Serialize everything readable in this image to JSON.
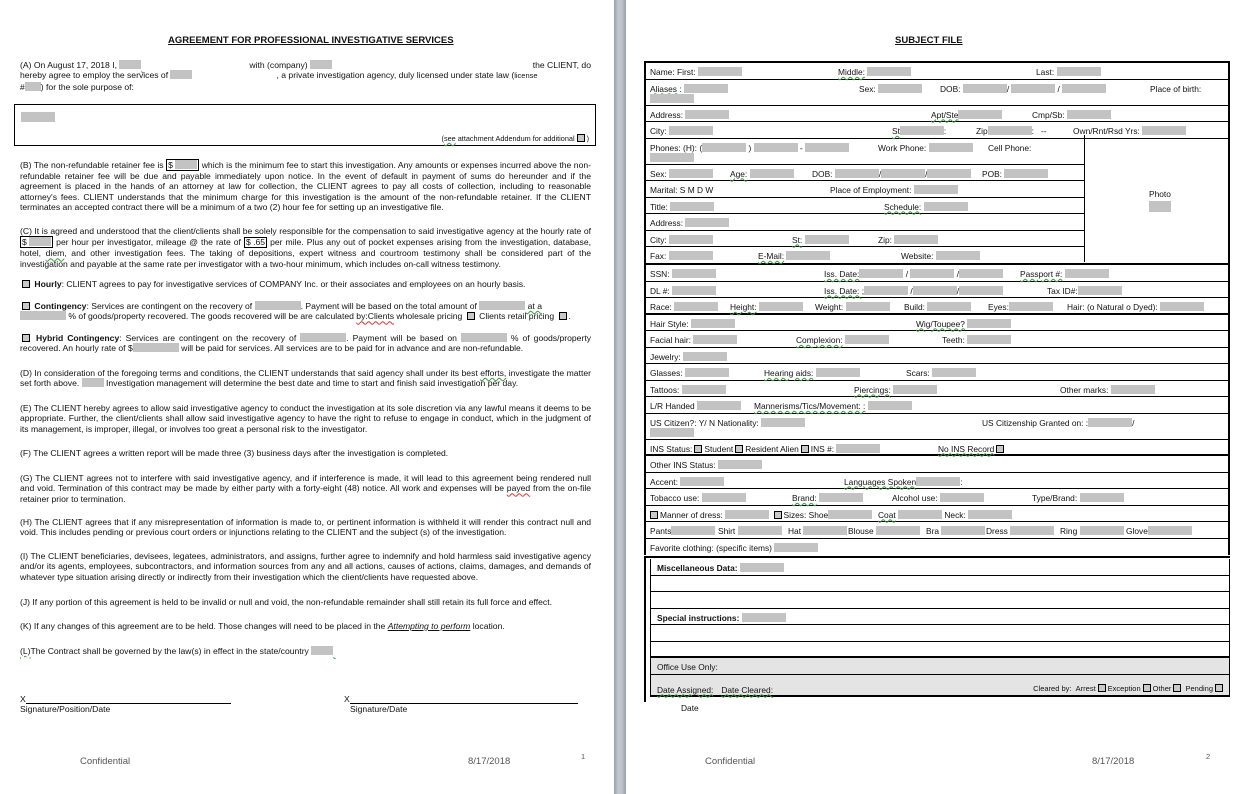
{
  "page1": {
    "title": "AGREEMENT FOR PROFESSIONAL INVESTIGATIVE SERVICES",
    "a": {
      "l1_start": "(A) On August 17, 2018    I,",
      "l1_with": "with (company)",
      "l1_end": "the CLIENT, do",
      "l2_start": "hereby agree to employ the services of",
      "l2_end": ", a private investigation agency, duly licensed under state law (",
      "l2_license": "license",
      "l3_hash": "#",
      "l3_end": ") for the sole purpose of:"
    },
    "purpose_note_see": "see",
    "purpose_note_rest": " attachment Addendum for additional",
    "b": {
      "start": "(B) The non-refundable retainer fee is ",
      "dollar": "$",
      "rest": " which is the minimum fee to start this investigation. Any amounts or expenses incurred above the non-refundable retainer fee will be due and payable immediately upon notice. In the event of default in payment of sums do hereunder and if the agreement is placed in the hands of an attorney at law for collection, the CLIENT agrees to pay all costs of collection, including to reasonable attorney's fees. CLIENT understands that the minimum charge for this investigation is the amount of the non-refundable retainer.  If the CLIENT terminates an accepted contract there will be a minimum of a two (2) hour fee for setting up an investigative file."
    },
    "c": {
      "start": "(C) It is agreed and understood that the client/clients shall be solely responsible for the compensation to said investigative agency at the hourly rate of ",
      "dollar": "$",
      "mid": " per hour per investigator, mileage @ the rate of ",
      "mileage": "$ .65",
      "rest1": " per mile. Plus any out of pocket expenses arising from the investigation, database, hotel, ",
      "diem": "diem",
      "rest2": ", and other investigation fees. The taking of depositions, expert witness and courtroom testimony shall be considered part of the investigation and payable at the same rate per investigator with a two-hour minimum, which includes on-call witness testimony."
    },
    "hourly": {
      "label": "Hourly",
      "text": ": CLIENT agrees to pay for investigative services of COMPANY Inc. or their associates and employees on an hourly basis."
    },
    "contingency": {
      "label": "Contingency",
      "t1": ": Services are contingent on the recovery of ",
      "t2": ".   Payment will be based on the total amount of ",
      "t3": " at a",
      "t4": " % of goods/property recovered.  The goods recovered will be are calculated ",
      "by_clients": "by:Clients",
      "t5": " wholesale pricing ",
      "t6": " Clients retail pricing ",
      "t7": "."
    },
    "hybrid": {
      "label": "Hybrid Contingency",
      "t1": ": Services are contingent on the recovery of ",
      "t2": ".  Payment will be based on ",
      "t3": " % of goods/property recovered. An hourly rate of $",
      "t4": " will be paid for services. All services are to be paid for in advance and are non-refundable."
    },
    "d": {
      "t1": "(D) In consideration of the foregoing terms and conditions, the CLIENT understands that said agency shall under its best ",
      "efforts": "efforts,",
      "t2": " investigate the matter set forth above. ",
      "t3": " Investigation management will determine the best date and time to start and finish said investigation per day."
    },
    "e": "(E) The CLIENT hereby agrees to allow said investigative agency to conduct the investigation at its sole discretion via any lawful means it deems to be appropriate. Further, the client/clients shall allow said investigative agency to have the right to refuse to engage in conduct, which in the judgment of its management, is improper, illegal, or involves too great a personal risk to the investigator.",
    "f": "(F) The CLIENT agrees a written report will be made three (3) business days after the investigation is completed.",
    "g": {
      "t1": "(G) The CLIENT agrees not to interfere with said investigative agency, and if interference is made, it will lead to this agreement being rendered null and void.  Termination of this contract may be made by either party with a forty-eight (48) notice.  All work and expenses will be ",
      "payed": "payed",
      "t2": " from the on-file retainer prior to termination."
    },
    "h": "(H) The CLIENT agrees that if any misrepresentation of information is made to, or pertinent information is withheld it will render this contract null and void.  This includes pending or previous court orders or injunctions relating to the CLIENT and the subject (s) of the investigation.",
    "i": "(I) The CLIENT beneficiaries, devisees, legatees, administrators, and assigns, further agree to indemnify and hold harmless said investigative agency and/or its agents, employees, subcontractors, and information sources from any and all actions, causes of actions, claims, damages, and demands of whatever type situation arising directly or indirectly from their investigation which the client/clients have requested above.",
    "j": "(J) If any portion of this agreement is held to be invalid or null and void, the non-refundable remainder shall still retain its full force and effect.",
    "k": {
      "t1": "(K) If any changes of this agreement are to be held. Those changes will need to be placed in the ",
      "link": "Attempting to perform",
      "t2": " location."
    },
    "l": {
      "mark": "(L)",
      "text": "The Contract shall be governed by the law(s) in effect in the state/country "
    },
    "sig_left_x": "X",
    "sig_left_label": "Signature/Position/Date",
    "sig_right_x": "X",
    "sig_right_label": "Signature/Date",
    "footer_left": "Confidential",
    "footer_date": "8/17/2018",
    "page_number": "1"
  },
  "page2": {
    "title": "SUBJECT FILE",
    "labels": {
      "name_first": "Name:  First:",
      "middle": "Middle:",
      "last": "Last:",
      "aliases": "Aliases :",
      "sex": "Sex:",
      "dob": "DOB:",
      "slash": "/",
      "place_of_birth": "Place of birth:",
      "address": "Address:",
      "apt": "Apt/Ste",
      "cmp": "Cmp/Sb:",
      "city": "City:",
      "st": "St",
      "colon": ":",
      "zip": "Zip",
      "dashes": "--",
      "own": "Own/Rnt/Rsd  Yrs:",
      "phones": "Phones:  (H): (",
      "paren": ")",
      "dash": "-",
      "work_phone": "Work Phone:",
      "cell_phone": "Cell Phone:",
      "sex2": "Sex:",
      "age": "Age:",
      "dob2": "DOB:",
      "pob": "POB:",
      "marital": "Marital: S M D W",
      "employment": "Place of Employment:",
      "title": "Title:",
      "schedule": "Schedule:",
      "address2": "Address:",
      "city2": "City:",
      "st2": "St:",
      "zip2": "Zip:",
      "fax": "Fax:",
      "email": "E-Mail:",
      "website": "Website:",
      "photo": "Photo",
      "ssn": "SSN:",
      "iss_date": "Iss. Date:",
      "passport": "Passport #:",
      "dl": "DL #:",
      "iss_date2": "Iss. Date: ;",
      "tax_id": "Tax ID#:",
      "race": "Race:",
      "height": "Height:",
      "weight": "Weight:",
      "build": "Build:",
      "eyes": "Eyes:",
      "hair": "Hair: (o Natural o Dyed):",
      "hair_style": "Hair Style:",
      "wig": "Wig/Toupee?",
      "facial_hair": "Facial hair:",
      "complexion": "Complexion:",
      "teeth": "Teeth:",
      "jewelry": "Jewelry:",
      "glasses": "Glasses:",
      "hearing": "Hearing aids:",
      "scars": "Scars:",
      "tattoos": "Tattoos:",
      "piercings": "Piercings:",
      "other_marks": "Other marks:",
      "lr_handed": "L/R Handed",
      "mannerisms": "Mannerisms/Tics/Movement: :",
      "us_citizen": "US Citizen?: Y/ N    Nationality:",
      "citizenship_granted": "US Citizenship Granted on: :",
      "ins_status": "INS Status:",
      "student": "Student",
      "resident_alien": "Resident Alien",
      "ins_num": "INS #:",
      "no_ins": "No INS Record",
      "other_ins": "Other INS Status:",
      "accent": "Accent:",
      "languages": "Languages Spoken",
      "tobacco": "Tobacco use:",
      "brand": "Brand:",
      "alcohol": "Alcohol use:",
      "type_brand": "Type/Brand:",
      "manner_dress": "Manner of dress:",
      "sizes_shoe": "Sizes: Shoe",
      "coat": "Coat",
      "neck": "Neck:",
      "pants": "Pants",
      "shirt": "Shirt",
      "hat": "Hat",
      "blouse": "Blouse",
      "bra": "Bra",
      "dress": "Dress",
      "ring": "Ring",
      "glove": "Glove",
      "favorite": "Favorite clothing: (specific items)",
      "misc": "Miscellaneous Data:",
      "special": "Special instructions:",
      "office": "Office Use Only:",
      "date_assigned": "Date Assigned:",
      "date_cleared": "Date Cleared:",
      "cleared_by": "Cleared by:",
      "arrest": "Arrest",
      "exception": "Exception",
      "other": "Other",
      "pending": "Pending",
      "date_below": "Date"
    },
    "footer_left": "Confidential",
    "footer_date": "8/17/2018",
    "page_number": "2"
  }
}
